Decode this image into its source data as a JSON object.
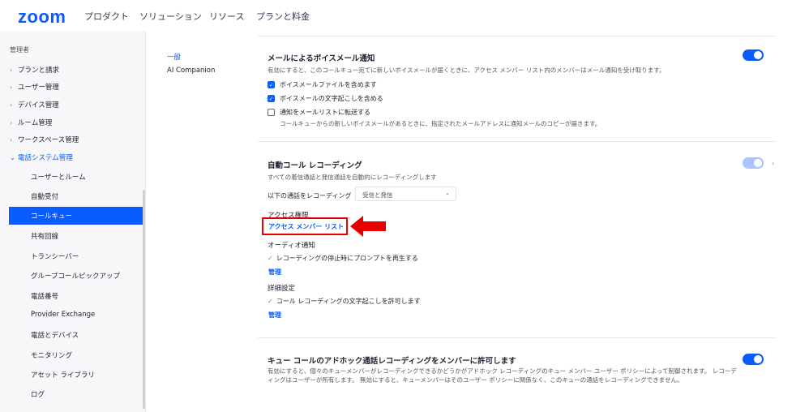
{
  "nav": {
    "logo": "zoom",
    "items": [
      "プロダクト",
      "ソリューション",
      "リソース",
      "プランと料金"
    ]
  },
  "sidebar": {
    "header": "管理者",
    "sections": [
      {
        "label": "プランと請求",
        "icon": "chevron-right-icon"
      },
      {
        "label": "ユーザー管理",
        "icon": "chevron-right-icon"
      },
      {
        "label": "デバイス管理",
        "icon": "chevron-right-icon"
      },
      {
        "label": "ルーム管理",
        "icon": "chevron-right-icon"
      },
      {
        "label": "ワークスペース管理",
        "icon": "chevron-right-icon"
      },
      {
        "label": "電話システム管理",
        "icon": "chevron-down-icon"
      }
    ],
    "subitems": [
      "ユーザーとルーム",
      "自動受付",
      "コールキュー",
      "共有回線",
      "トランシーバー",
      "グループコールピックアップ",
      "電話番号",
      "Provider Exchange",
      "電話とデバイス",
      "モニタリング",
      "アセット ライブラリ",
      "ログ"
    ],
    "active": "コールキュー"
  },
  "subnav": {
    "items": [
      "一般",
      "AI Companion"
    ],
    "active": "一般"
  },
  "voicemail": {
    "title": "メールによるボイスメール通知",
    "desc": "有効にすると、このコールキュー宛てに新しいボイスメールが届くときに、アクセス メンバー リスト内のメンバーはメール通知を受け取ります。",
    "enabled": true,
    "options": [
      {
        "label": "ボイスメールファイルを含めます",
        "checked": true
      },
      {
        "label": "ボイスメールの文字起こしを含める",
        "checked": true
      },
      {
        "label": "通知をメールリストに転送する",
        "checked": false
      }
    ],
    "forward_desc": "コールキューからの新しいボイスメールがあるときに、指定されたメールアドレスに通知メールのコピーが届きます。"
  },
  "auto_record": {
    "title": "自動コール レコーディング",
    "desc": "すべての着信通話と発信通話を自動的にレコーディングします",
    "enabled": true,
    "record_label": "以下の通話をレコーディング",
    "record_value": "受信と発信",
    "access_title": "アクセス権限",
    "access_link": "アクセス メンバー リスト",
    "audio_title": "オーディオ通知",
    "audio_item": "レコーディングの停止時にプロンプトを再生する",
    "audio_manage": "管理",
    "adv_title": "詳細設定",
    "adv_item": "コール レコーディングの文字起こしを許可します",
    "adv_manage": "管理"
  },
  "adhoc": {
    "title": "キュー コールのアドホック通話レコーディングをメンバーに許可します",
    "desc": "有効にすると、個々のキューメンバーがレコーディングできるかどうかがアドホック レコーディングのキュー メンバー ユーザー ポリシーによって制御されます。 レコーディングはユーザーが所有します。 無効にすると、キューメンバーはそのユーザー ポリシーに関係なく、このキューの通話をレコーディングできません。",
    "enabled": true
  },
  "colors": {
    "accent": "#0b5cff",
    "highlight": "#e60000"
  }
}
